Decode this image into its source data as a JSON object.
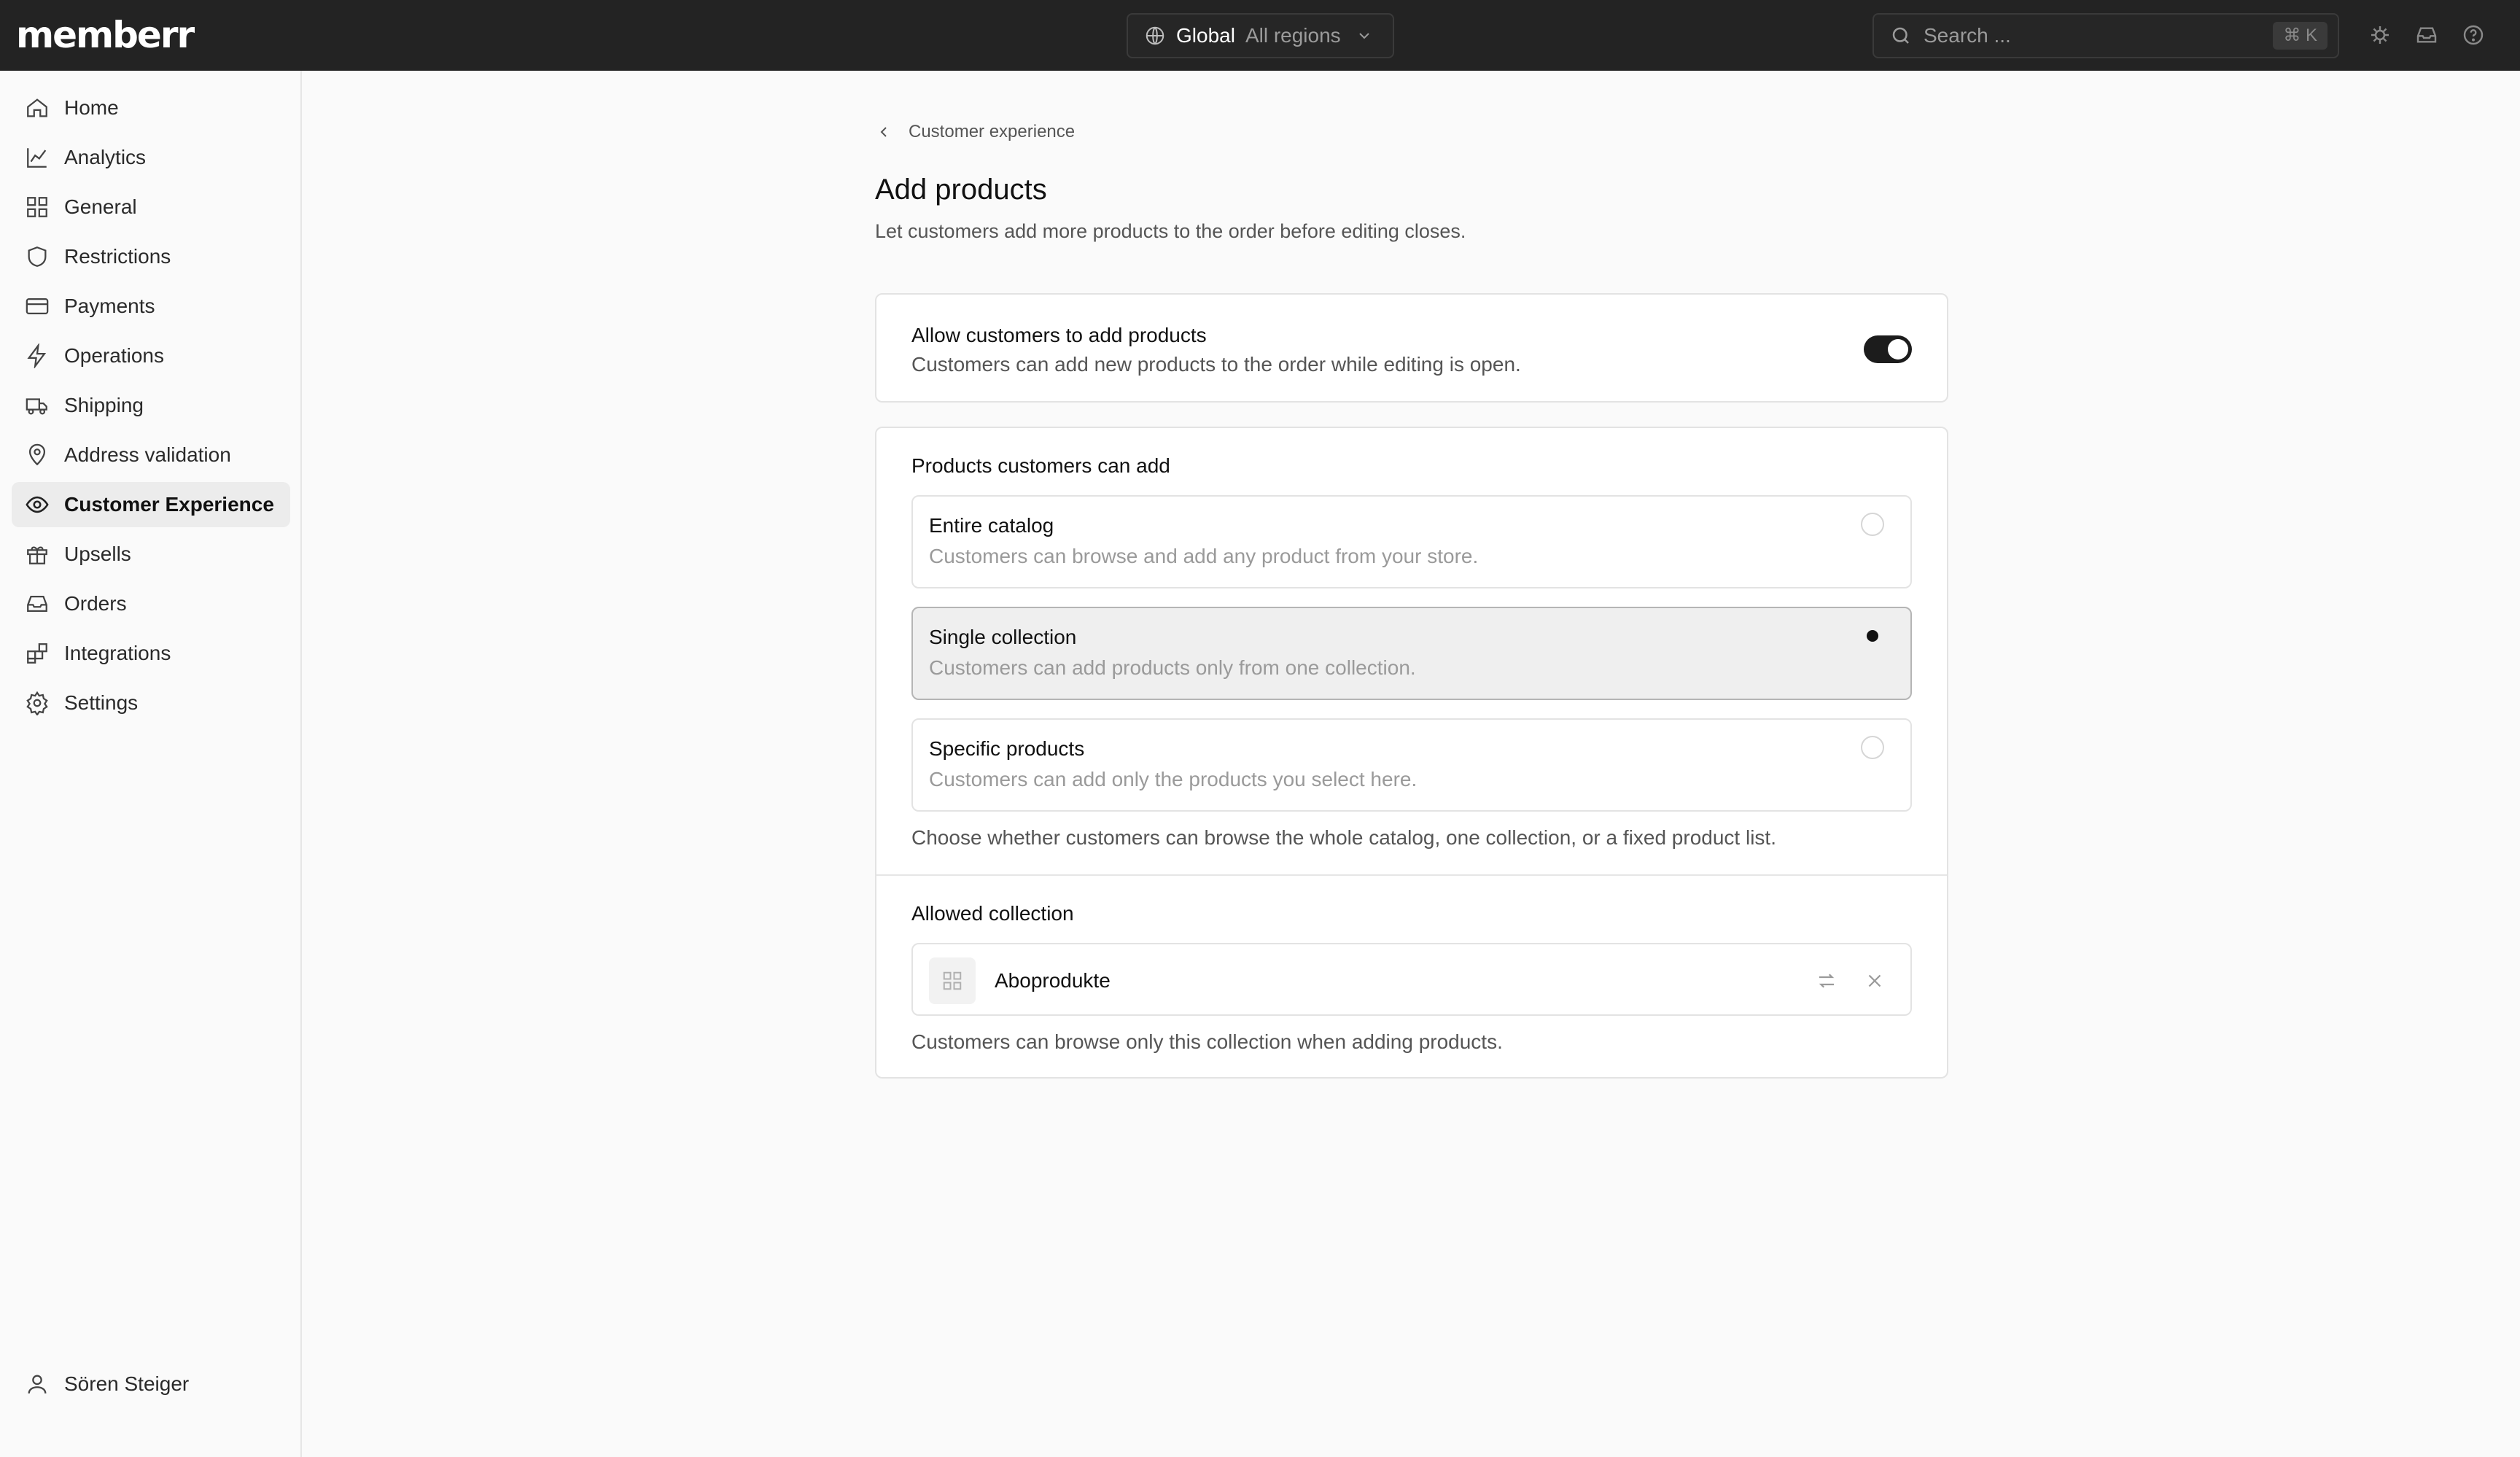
{
  "app": {
    "logo": "memberr"
  },
  "topbar": {
    "region_title": "Global",
    "region_sub": "All regions",
    "search_placeholder": "Search ...",
    "search_shortcut": "⌘ K",
    "icons": [
      "bug-icon",
      "inbox-icon",
      "help-icon"
    ]
  },
  "sidebar": {
    "items": [
      {
        "label": "Home",
        "icon": "home-icon"
      },
      {
        "label": "Analytics",
        "icon": "chart-line-icon"
      },
      {
        "label": "General",
        "icon": "grid-icon"
      },
      {
        "label": "Restrictions",
        "icon": "shield-icon"
      },
      {
        "label": "Payments",
        "icon": "credit-card-icon"
      },
      {
        "label": "Operations",
        "icon": "bolt-icon"
      },
      {
        "label": "Shipping",
        "icon": "truck-icon"
      },
      {
        "label": "Address validation",
        "icon": "map-pin-icon"
      },
      {
        "label": "Customer Experience",
        "icon": "eye-icon",
        "active": true
      },
      {
        "label": "Upsells",
        "icon": "gift-icon"
      },
      {
        "label": "Orders",
        "icon": "inbox-icon"
      },
      {
        "label": "Integrations",
        "icon": "blocks-icon"
      },
      {
        "label": "Settings",
        "icon": "gear-icon"
      }
    ],
    "user_name": "Sören Steiger"
  },
  "main": {
    "breadcrumb": "Customer experience",
    "title": "Add products",
    "description": "Let customers add more products to the order before editing closes.",
    "allow": {
      "title": "Allow customers to add products",
      "description": "Customers can add new products to the order while editing is open.",
      "enabled": true
    },
    "products": {
      "label": "Products customers can add",
      "options": [
        {
          "title": "Entire catalog",
          "description": "Customers can browse and add any product from your store.",
          "selected": false
        },
        {
          "title": "Single collection",
          "description": "Customers can add products only from one collection.",
          "selected": true
        },
        {
          "title": "Specific products",
          "description": "Customers can add only the products you select here.",
          "selected": false
        }
      ],
      "help": "Choose whether customers can browse the whole catalog, one collection, or a fixed product list."
    },
    "collection": {
      "label": "Allowed collection",
      "name": "Aboprodukte",
      "help": "Customers can browse only this collection when adding products."
    }
  }
}
